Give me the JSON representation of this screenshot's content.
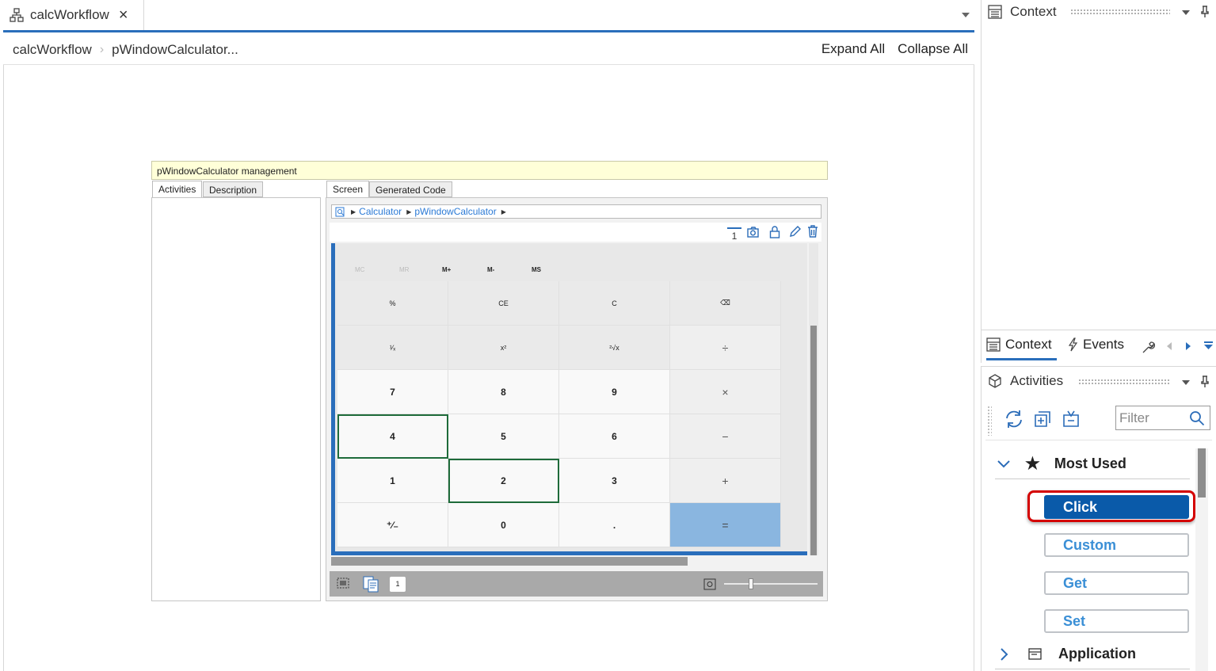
{
  "editor": {
    "tab_label": "calcWorkflow",
    "close_icon": "×",
    "breadcrumb": [
      "calcWorkflow",
      "pWindowCalculator..."
    ],
    "expand_all": "Expand All",
    "collapse_all": "Collapse All"
  },
  "management": {
    "title": "pWindowCalculator management",
    "left_tabs": [
      "Activities",
      "Description"
    ],
    "right_tabs": [
      "Screen",
      "Generated Code"
    ],
    "screen_path": [
      "Calculator",
      "pWindowCalculator"
    ],
    "page_number": "1",
    "calculator": {
      "memory": [
        "MC",
        "MR",
        "M+",
        "M-",
        "MS"
      ],
      "keys": [
        {
          "label": "%",
          "kind": "fn"
        },
        {
          "label": "CE",
          "kind": "fn"
        },
        {
          "label": "C",
          "kind": "fn"
        },
        {
          "label": "⌫",
          "kind": "fn"
        },
        {
          "label": "¹⁄ₓ",
          "kind": "fn"
        },
        {
          "label": "x²",
          "kind": "fn"
        },
        {
          "label": "²√x",
          "kind": "fn"
        },
        {
          "label": "÷",
          "kind": "op"
        },
        {
          "label": "7",
          "kind": "num"
        },
        {
          "label": "8",
          "kind": "num"
        },
        {
          "label": "9",
          "kind": "num"
        },
        {
          "label": "×",
          "kind": "op"
        },
        {
          "label": "4",
          "kind": "num",
          "selected": true
        },
        {
          "label": "5",
          "kind": "num"
        },
        {
          "label": "6",
          "kind": "num"
        },
        {
          "label": "−",
          "kind": "op"
        },
        {
          "label": "1",
          "kind": "num"
        },
        {
          "label": "2",
          "kind": "num",
          "selected": true
        },
        {
          "label": "3",
          "kind": "num"
        },
        {
          "label": "+",
          "kind": "op"
        },
        {
          "label": "⁺⁄₋",
          "kind": "num"
        },
        {
          "label": "0",
          "kind": "num"
        },
        {
          "label": ".",
          "kind": "num"
        },
        {
          "label": "=",
          "kind": "eq"
        }
      ]
    },
    "bottom_page": "1"
  },
  "right_panel": {
    "context_title": "Context",
    "tabs": [
      "Context",
      "Events"
    ],
    "activities_title": "Activities",
    "filter_placeholder": "Filter",
    "groups": [
      {
        "label": "Most Used",
        "icon": "star-icon",
        "expanded": true,
        "items": [
          "Click",
          "Custom",
          "Get",
          "Set"
        ]
      },
      {
        "label": "Application",
        "icon": "window-icon",
        "expanded": false
      }
    ]
  },
  "colors": {
    "accent": "#2a6ebb",
    "primary_button": "#0a5aa9",
    "highlight": "#d40000",
    "selection": "#1e6b3a"
  }
}
